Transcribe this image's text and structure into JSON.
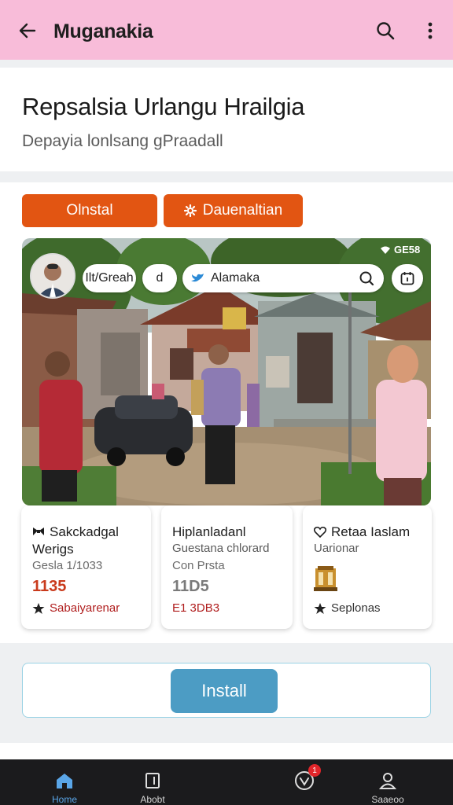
{
  "appbar": {
    "title": "Muganakia",
    "icons": {
      "back": "arrow-left-icon",
      "search": "search-icon",
      "more": "more-vert-icon"
    }
  },
  "header": {
    "title": "Repsalsia Urlangu Hrailgia",
    "subtitle": "Depayia lonlsang gPraadall"
  },
  "actions": {
    "primary_label": "Olnstal",
    "secondary_label": "Dauenaltian",
    "secondary_icon": "gear-icon"
  },
  "photo_overlay": {
    "status_time": "GE58",
    "pill_a": "Ilt/Greah",
    "pill_b": "d",
    "search_label": "Alamaka",
    "icons": {
      "twitter": "bird-icon",
      "search": "search-icon",
      "calendar": "calendar-icon",
      "wifi": "wifi-icon"
    }
  },
  "tiles": [
    {
      "title_line1": "Sakckadgal",
      "title_line2": "Werigs",
      "subtitle": "Gesla 1/1033",
      "price": "1135",
      "price_color": "#c93a1c",
      "footer": "Sabaiyarenar",
      "footer_color": "#b01e1e",
      "title_icon": "bow-icon",
      "footer_icon": "star-icon"
    },
    {
      "title_line1": "Hiplanladanl",
      "title_line2": "Guestana chlorard",
      "subtitle": "Con Prsta",
      "price": "11D5",
      "price_color": "#7a7a7a",
      "footer": "E1 3DB3",
      "footer_color": "#b01e1e"
    },
    {
      "title_line1": "Retaa Iaslam",
      "title_line2": "Uarionar",
      "footer": "Seplonas",
      "footer_color": "#333333",
      "title_icon": "heart-icon",
      "footer_icon": "star-icon",
      "image_icon": "building-icon"
    }
  ],
  "install": {
    "label": "Install"
  },
  "bottom_nav": [
    {
      "label": "Home",
      "icon": "home-icon",
      "active": true,
      "color": "#5aa6e8"
    },
    {
      "label": "Abobt",
      "icon": "book-icon"
    },
    {
      "label": "",
      "icon": "check-circle-icon",
      "badge": "1"
    },
    {
      "label": "Saaeoo",
      "icon": "user-icon"
    }
  ],
  "colors": {
    "appbar_bg": "#f8bcd9",
    "accent_orange": "#e25512",
    "install_blue": "#4c9cc4",
    "nav_bg": "#1b1b1d"
  }
}
